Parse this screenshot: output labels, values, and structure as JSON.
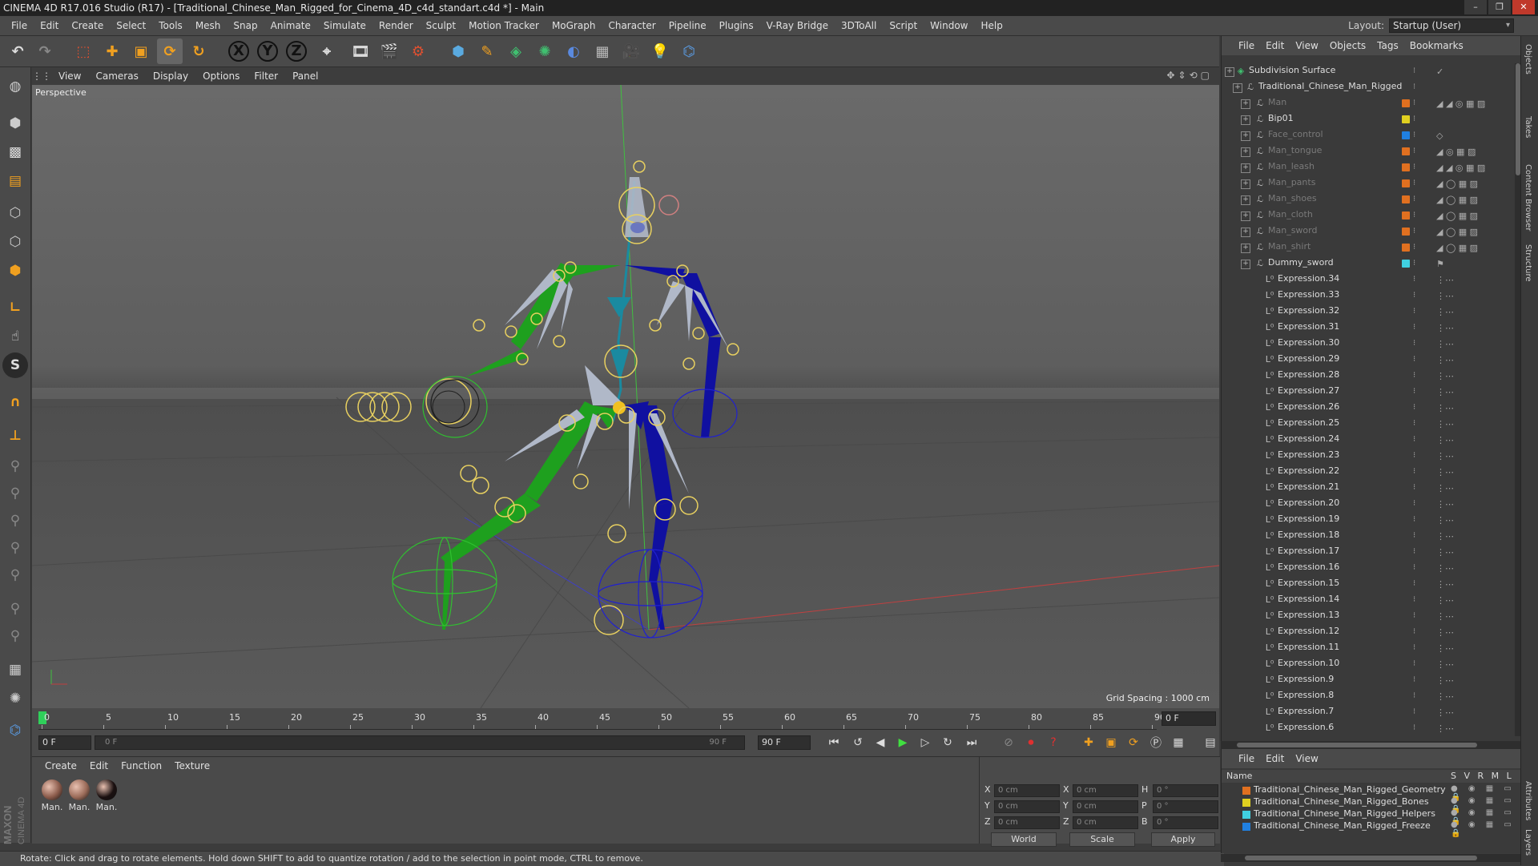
{
  "window": {
    "title": "CINEMA 4D R17.016 Studio (R17) - [Traditional_Chinese_Man_Rigged_for_Cinema_4D_c4d_standart.c4d *] - Main"
  },
  "menubar": {
    "items": [
      "File",
      "Edit",
      "Create",
      "Select",
      "Tools",
      "Mesh",
      "Snap",
      "Animate",
      "Simulate",
      "Render",
      "Sculpt",
      "Motion Tracker",
      "MoGraph",
      "Character",
      "Pipeline",
      "Plugins",
      "V-Ray Bridge",
      "3DToAll",
      "Script",
      "Window",
      "Help"
    ],
    "layout_label": "Layout:",
    "layout_value": "Startup (User)"
  },
  "toolbar": {
    "axis_x": "X",
    "axis_y": "Y",
    "axis_z": "Z"
  },
  "viewport": {
    "menu": [
      "View",
      "Cameras",
      "Display",
      "Options",
      "Filter",
      "Panel"
    ],
    "camera_label": "Perspective",
    "grid_spacing": "Grid Spacing : 1000 cm"
  },
  "timeline": {
    "ticks": [
      0,
      5,
      10,
      15,
      20,
      25,
      30,
      35,
      40,
      45,
      50,
      55,
      60,
      65,
      70,
      75,
      80,
      85,
      90
    ],
    "current_frame_right": "0 F",
    "start_frame": "0 F",
    "slider_left": "0 F",
    "slider_right": "90 F",
    "end_frame": "90 F"
  },
  "materials": {
    "menu": [
      "Create",
      "Edit",
      "Function",
      "Texture"
    ],
    "items": [
      {
        "label": "Man.",
        "color": "#8a5a4a"
      },
      {
        "label": "Man.",
        "color": "#9a6a58"
      },
      {
        "label": "Man.",
        "color": "#1a1010"
      }
    ]
  },
  "attributes": {
    "coords": [
      {
        "axis": "X",
        "pos": "0 cm",
        "axis2": "X",
        "size": "0 cm",
        "rot_axis": "H",
        "rot": "0 °"
      },
      {
        "axis": "Y",
        "pos": "0 cm",
        "axis2": "Y",
        "size": "0 cm",
        "rot_axis": "P",
        "rot": "0 °"
      },
      {
        "axis": "Z",
        "pos": "0 cm",
        "axis2": "Z",
        "size": "0 cm",
        "rot_axis": "B",
        "rot": "0 °"
      }
    ],
    "space": "World",
    "mode": "Scale",
    "apply": "Apply"
  },
  "status": {
    "text": "Rotate: Click and drag to rotate elements. Hold down SHIFT to add to quantize rotation / add to the selection in point mode, CTRL to remove."
  },
  "objects": {
    "menu": [
      "File",
      "Edit",
      "View",
      "Objects",
      "Tags",
      "Bookmarks"
    ],
    "rows": [
      {
        "name": "Subdivision Surface",
        "indent": 0,
        "dim": false,
        "color": "",
        "tags": "✓"
      },
      {
        "name": "Traditional_Chinese_Man_Rigged",
        "indent": 1,
        "dim": false,
        "color": "",
        "tags": ""
      },
      {
        "name": "Man",
        "indent": 2,
        "dim": true,
        "color": "#e07020",
        "tags": "◢ ◢ ◎ ▦ ▨"
      },
      {
        "name": "Bip01",
        "indent": 2,
        "dim": false,
        "color": "#e0d020",
        "tags": ""
      },
      {
        "name": "Face_control",
        "indent": 2,
        "dim": true,
        "color": "#2080e0",
        "tags": "◇"
      },
      {
        "name": "Man_tongue",
        "indent": 2,
        "dim": true,
        "color": "#e07020",
        "tags": "◢ ◎ ▦ ▨"
      },
      {
        "name": "Man_leash",
        "indent": 2,
        "dim": true,
        "color": "#e07020",
        "tags": "◢ ◢ ◎ ▦ ▨"
      },
      {
        "name": "Man_pants",
        "indent": 2,
        "dim": true,
        "color": "#e07020",
        "tags": "◢ ◯ ▦ ▨"
      },
      {
        "name": "Man_shoes",
        "indent": 2,
        "dim": true,
        "color": "#e07020",
        "tags": "◢ ◯ ▦ ▨"
      },
      {
        "name": "Man_cloth",
        "indent": 2,
        "dim": true,
        "color": "#e07020",
        "tags": "◢ ◯ ▦ ▨"
      },
      {
        "name": "Man_sword",
        "indent": 2,
        "dim": true,
        "color": "#e07020",
        "tags": "◢ ◯ ▦ ▨"
      },
      {
        "name": "Man_shirt",
        "indent": 2,
        "dim": true,
        "color": "#e07020",
        "tags": "◢ ◯ ▦ ▨"
      },
      {
        "name": "Dummy_sword",
        "indent": 2,
        "dim": false,
        "color": "#40d0e0",
        "tags": "⚑"
      },
      {
        "name": "Expression.34",
        "indent": 3,
        "dim": false,
        "color": "",
        "tags": "⋮⋯"
      },
      {
        "name": "Expression.33",
        "indent": 3,
        "dim": false,
        "color": "",
        "tags": "⋮⋯"
      },
      {
        "name": "Expression.32",
        "indent": 3,
        "dim": false,
        "color": "",
        "tags": "⋮⋯"
      },
      {
        "name": "Expression.31",
        "indent": 3,
        "dim": false,
        "color": "",
        "tags": "⋮⋯"
      },
      {
        "name": "Expression.30",
        "indent": 3,
        "dim": false,
        "color": "",
        "tags": "⋮⋯"
      },
      {
        "name": "Expression.29",
        "indent": 3,
        "dim": false,
        "color": "",
        "tags": "⋮⋯"
      },
      {
        "name": "Expression.28",
        "indent": 3,
        "dim": false,
        "color": "",
        "tags": "⋮⋯"
      },
      {
        "name": "Expression.27",
        "indent": 3,
        "dim": false,
        "color": "",
        "tags": "⋮⋯"
      },
      {
        "name": "Expression.26",
        "indent": 3,
        "dim": false,
        "color": "",
        "tags": "⋮⋯"
      },
      {
        "name": "Expression.25",
        "indent": 3,
        "dim": false,
        "color": "",
        "tags": "⋮⋯"
      },
      {
        "name": "Expression.24",
        "indent": 3,
        "dim": false,
        "color": "",
        "tags": "⋮⋯"
      },
      {
        "name": "Expression.23",
        "indent": 3,
        "dim": false,
        "color": "",
        "tags": "⋮⋯"
      },
      {
        "name": "Expression.22",
        "indent": 3,
        "dim": false,
        "color": "",
        "tags": "⋮⋯"
      },
      {
        "name": "Expression.21",
        "indent": 3,
        "dim": false,
        "color": "",
        "tags": "⋮⋯"
      },
      {
        "name": "Expression.20",
        "indent": 3,
        "dim": false,
        "color": "",
        "tags": "⋮⋯"
      },
      {
        "name": "Expression.19",
        "indent": 3,
        "dim": false,
        "color": "",
        "tags": "⋮⋯"
      },
      {
        "name": "Expression.18",
        "indent": 3,
        "dim": false,
        "color": "",
        "tags": "⋮⋯"
      },
      {
        "name": "Expression.17",
        "indent": 3,
        "dim": false,
        "color": "",
        "tags": "⋮⋯"
      },
      {
        "name": "Expression.16",
        "indent": 3,
        "dim": false,
        "color": "",
        "tags": "⋮⋯"
      },
      {
        "name": "Expression.15",
        "indent": 3,
        "dim": false,
        "color": "",
        "tags": "⋮⋯"
      },
      {
        "name": "Expression.14",
        "indent": 3,
        "dim": false,
        "color": "",
        "tags": "⋮⋯"
      },
      {
        "name": "Expression.13",
        "indent": 3,
        "dim": false,
        "color": "",
        "tags": "⋮⋯"
      },
      {
        "name": "Expression.12",
        "indent": 3,
        "dim": false,
        "color": "",
        "tags": "⋮⋯"
      },
      {
        "name": "Expression.11",
        "indent": 3,
        "dim": false,
        "color": "",
        "tags": "⋮⋯"
      },
      {
        "name": "Expression.10",
        "indent": 3,
        "dim": false,
        "color": "",
        "tags": "⋮⋯"
      },
      {
        "name": "Expression.9",
        "indent": 3,
        "dim": false,
        "color": "",
        "tags": "⋮⋯"
      },
      {
        "name": "Expression.8",
        "indent": 3,
        "dim": false,
        "color": "",
        "tags": "⋮⋯"
      },
      {
        "name": "Expression.7",
        "indent": 3,
        "dim": false,
        "color": "",
        "tags": "⋮⋯"
      },
      {
        "name": "Expression.6",
        "indent": 3,
        "dim": false,
        "color": "",
        "tags": "⋮⋯"
      }
    ]
  },
  "layers": {
    "menu": [
      "File",
      "Edit",
      "View"
    ],
    "header_name": "Name",
    "header_flags": "S V R M L",
    "rows": [
      {
        "name": "Traditional_Chinese_Man_Rigged_Geometry",
        "color": "#e07020"
      },
      {
        "name": "Traditional_Chinese_Man_Rigged_Bones",
        "color": "#e0d020"
      },
      {
        "name": "Traditional_Chinese_Man_Rigged_Helpers",
        "color": "#40d0e0"
      },
      {
        "name": "Traditional_Chinese_Man_Rigged_Freeze",
        "color": "#2080e0"
      }
    ]
  },
  "sidetabs": [
    "Objects",
    "Takes",
    "Content Browser",
    "Structure",
    "Attributes",
    "Layers"
  ],
  "brand": {
    "line1": "MAXON",
    "line2": "CINEMA 4D"
  }
}
